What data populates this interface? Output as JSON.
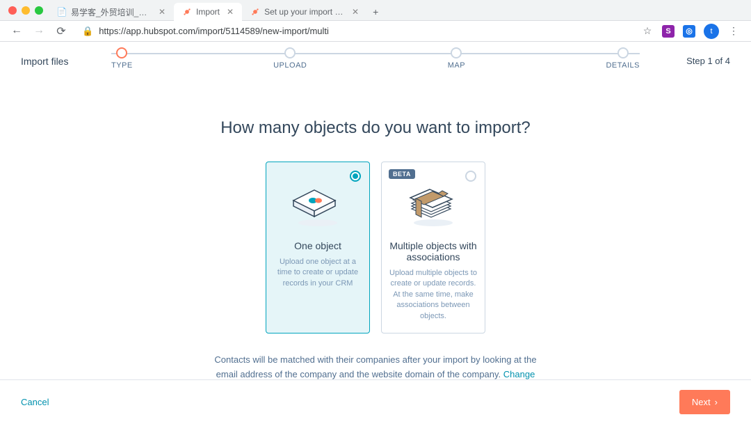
{
  "browser": {
    "tabs": [
      {
        "title": "易学客_外贸培训_外贸业务培训"
      },
      {
        "title": "Import"
      },
      {
        "title": "Set up your import file"
      }
    ],
    "url": "https://app.hubspot.com/import/5114589/new-import/multi",
    "avatar_initial": "t"
  },
  "header": {
    "title": "Import files",
    "step_indicator": "Step 1 of 4"
  },
  "stepper": [
    {
      "label": "TYPE"
    },
    {
      "label": "UPLOAD"
    },
    {
      "label": "MAP"
    },
    {
      "label": "DETAILS"
    }
  ],
  "question": "How many objects do you want to import?",
  "cards": [
    {
      "title": "One object",
      "desc": "Upload one object at a time to create or update records in your CRM"
    },
    {
      "badge": "BETA",
      "title": "Multiple objects with associations",
      "desc": "Upload multiple objects to create or update records. At the same time, make associations between objects."
    }
  ],
  "note_text": "Contacts will be matched with their companies after your import by looking at the email address of the company and the website domain of the company. ",
  "note_link": "Change this setting",
  "footer": {
    "cancel": "Cancel",
    "next": "Next"
  }
}
